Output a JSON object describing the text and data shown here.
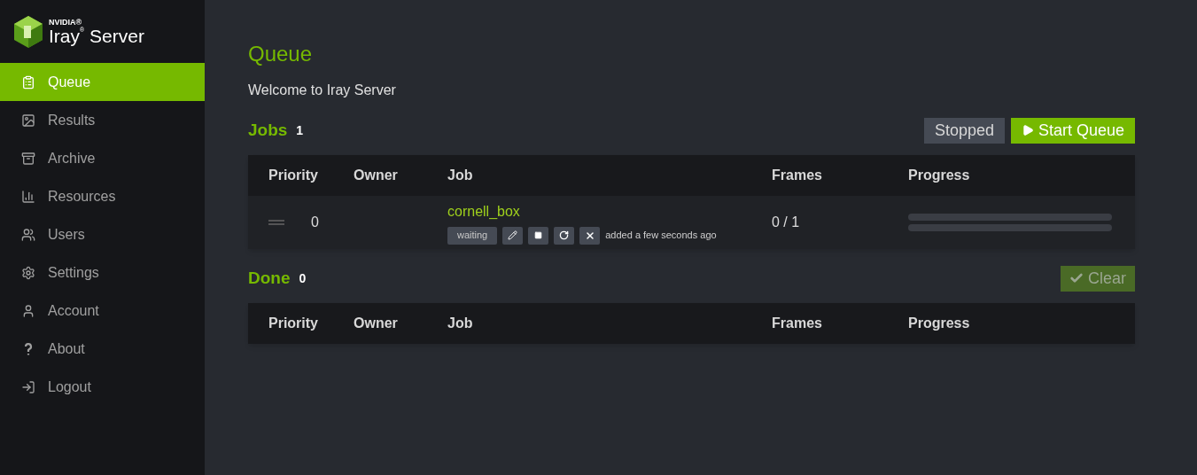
{
  "logo": {
    "brand": "NVIDIA®",
    "product": "Iray$^{®}$ Server"
  },
  "sidebar": {
    "items": [
      {
        "label": "Queue",
        "selected": true
      },
      {
        "label": "Results",
        "selected": false
      },
      {
        "label": "Archive",
        "selected": false
      },
      {
        "label": "Resources",
        "selected": false
      },
      {
        "label": "Users",
        "selected": false
      },
      {
        "label": "Settings",
        "selected": false
      },
      {
        "label": "Account",
        "selected": false
      },
      {
        "label": "About",
        "selected": false
      },
      {
        "label": "Logout",
        "selected": false
      }
    ]
  },
  "page": {
    "title": "Queue",
    "welcome": "Welcome to Iray Server"
  },
  "jobs": {
    "title": "Jobs",
    "count": "1",
    "status": "Stopped",
    "start_button": "Start Queue",
    "columns": [
      "Priority",
      "Owner",
      "Job",
      "Frames",
      "Progress"
    ],
    "rows": [
      {
        "priority": "0",
        "job": "cornell_box",
        "state": "waiting",
        "added": "added a few seconds ago",
        "frames": "0 / 1"
      }
    ]
  },
  "done": {
    "title": "Done",
    "count": "0",
    "clear_button": {
      "label": "Clear",
      "disabled": true
    },
    "columns": [
      "Priority",
      "Owner",
      "Job",
      "Frames",
      "Progress"
    ]
  }
}
